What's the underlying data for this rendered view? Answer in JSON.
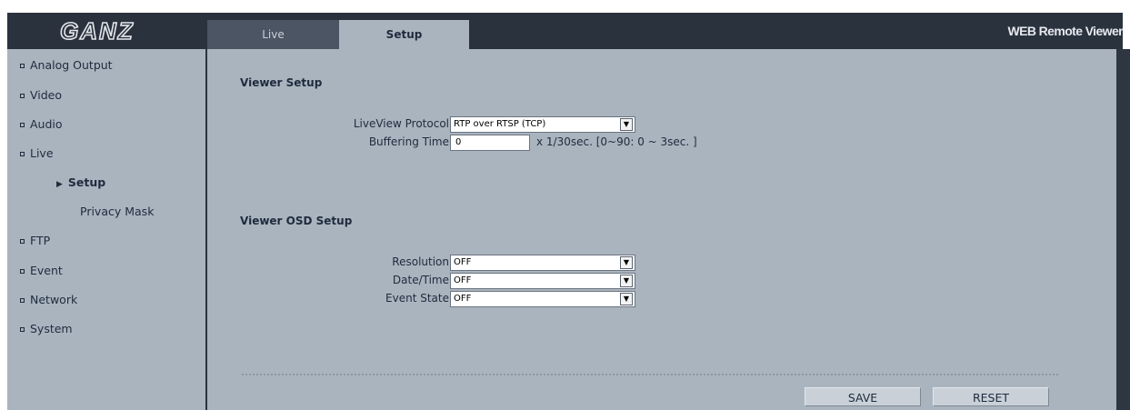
{
  "header": {
    "logo_text": "GANZ",
    "app_title": "WEB Remote Viewer",
    "tabs": [
      {
        "label": "Live"
      },
      {
        "label": "Setup"
      }
    ]
  },
  "sidebar": {
    "items": [
      {
        "label": "Analog Output"
      },
      {
        "label": "Video"
      },
      {
        "label": "Audio"
      },
      {
        "label": "Live"
      },
      {
        "label": "FTP"
      },
      {
        "label": "Event"
      },
      {
        "label": "Network"
      },
      {
        "label": "System"
      }
    ],
    "sub_items": [
      {
        "label": "Setup",
        "active": true
      },
      {
        "label": "Privacy Mask",
        "active": false
      }
    ]
  },
  "viewer_setup": {
    "title": "Viewer Setup",
    "liveview_protocol": {
      "label": "LiveView Protocol",
      "value": "RTP over RTSP (TCP)"
    },
    "buffering_time": {
      "label": "Buffering Time",
      "value": "0",
      "hint": "x 1/30sec. [0~90: 0 ~ 3sec. ]"
    }
  },
  "osd_setup": {
    "title": "Viewer OSD Setup",
    "resolution": {
      "label": "Resolution",
      "value": "OFF"
    },
    "datetime": {
      "label": "Date/Time",
      "value": "OFF"
    },
    "event_state": {
      "label": "Event State",
      "value": "OFF"
    }
  },
  "actions": {
    "save_label": "SAVE",
    "reset_label": "RESET"
  },
  "colors": {
    "panel": "#aab4bf",
    "frame": "#2e3642",
    "tab_inactive": "#4b5563"
  }
}
